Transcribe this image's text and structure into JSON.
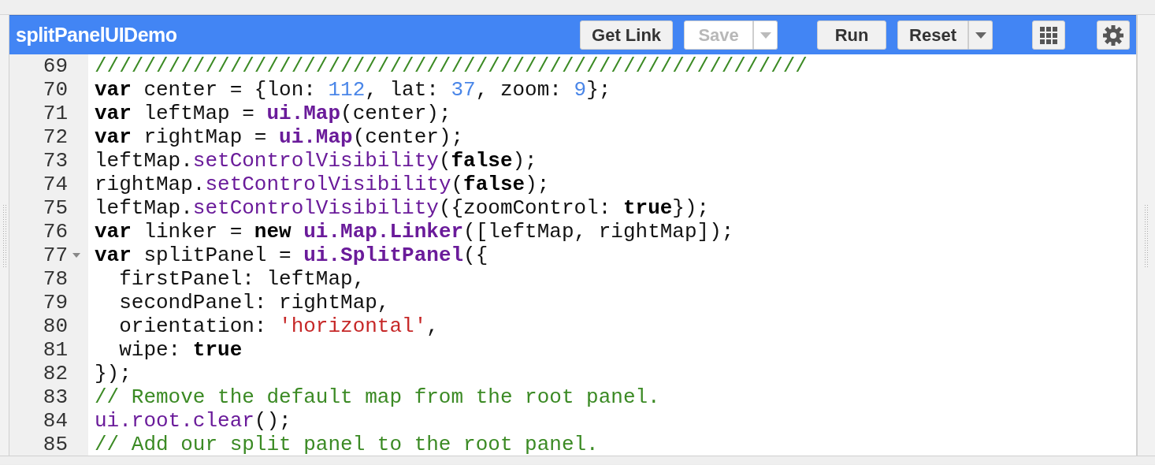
{
  "toolbar": {
    "title": "splitPanelUIDemo",
    "buttons": [
      {
        "label": "Get Link",
        "kind": "plain",
        "disabled": false
      },
      {
        "label": "Save",
        "kind": "split",
        "disabled": true
      },
      {
        "label": "Run",
        "kind": "plain",
        "disabled": false
      },
      {
        "label": "Reset",
        "kind": "split",
        "disabled": false
      },
      {
        "kind": "apps"
      },
      {
        "kind": "settings"
      }
    ]
  },
  "editor": {
    "lines": [
      {
        "number": "69",
        "foldable": false,
        "tokens": [
          {
            "kind": "com",
            "t": "//////////////////////////////////////////////////////////"
          }
        ]
      },
      {
        "number": "70",
        "foldable": false,
        "tokens": [
          {
            "kind": "kw",
            "t": "var"
          },
          {
            "kind": "plain",
            "t": " center = {lon: "
          },
          {
            "kind": "num",
            "t": "112"
          },
          {
            "kind": "plain",
            "t": ", lat: "
          },
          {
            "kind": "num",
            "t": "37"
          },
          {
            "kind": "plain",
            "t": ", zoom: "
          },
          {
            "kind": "num",
            "t": "9"
          },
          {
            "kind": "plain",
            "t": "};"
          }
        ]
      },
      {
        "number": "71",
        "foldable": false,
        "tokens": [
          {
            "kind": "kw",
            "t": "var"
          },
          {
            "kind": "plain",
            "t": " leftMap = "
          },
          {
            "kind": "fnb",
            "t": "ui.Map"
          },
          {
            "kind": "plain",
            "t": "(center);"
          }
        ]
      },
      {
        "number": "72",
        "foldable": false,
        "tokens": [
          {
            "kind": "kw",
            "t": "var"
          },
          {
            "kind": "plain",
            "t": " rightMap = "
          },
          {
            "kind": "fnb",
            "t": "ui.Map"
          },
          {
            "kind": "plain",
            "t": "(center);"
          }
        ]
      },
      {
        "number": "73",
        "foldable": false,
        "tokens": [
          {
            "kind": "plain",
            "t": "leftMap."
          },
          {
            "kind": "fn",
            "t": "setControlVisibility"
          },
          {
            "kind": "plain",
            "t": "("
          },
          {
            "kind": "kw",
            "t": "false"
          },
          {
            "kind": "plain",
            "t": ");"
          }
        ]
      },
      {
        "number": "74",
        "foldable": false,
        "tokens": [
          {
            "kind": "plain",
            "t": "rightMap."
          },
          {
            "kind": "fn",
            "t": "setControlVisibility"
          },
          {
            "kind": "plain",
            "t": "("
          },
          {
            "kind": "kw",
            "t": "false"
          },
          {
            "kind": "plain",
            "t": ");"
          }
        ]
      },
      {
        "number": "75",
        "foldable": false,
        "tokens": [
          {
            "kind": "plain",
            "t": "leftMap."
          },
          {
            "kind": "fn",
            "t": "setControlVisibility"
          },
          {
            "kind": "plain",
            "t": "({zoomControl: "
          },
          {
            "kind": "kw",
            "t": "true"
          },
          {
            "kind": "plain",
            "t": "});"
          }
        ]
      },
      {
        "number": "76",
        "foldable": false,
        "tokens": [
          {
            "kind": "kw",
            "t": "var"
          },
          {
            "kind": "plain",
            "t": " linker = "
          },
          {
            "kind": "kw",
            "t": "new"
          },
          {
            "kind": "fnb",
            "t": " ui.Map.Linker"
          },
          {
            "kind": "plain",
            "t": "([leftMap, rightMap]);"
          }
        ]
      },
      {
        "number": "77",
        "foldable": true,
        "tokens": [
          {
            "kind": "kw",
            "t": "var"
          },
          {
            "kind": "plain",
            "t": " splitPanel = "
          },
          {
            "kind": "fnb",
            "t": "ui.SplitPanel"
          },
          {
            "kind": "plain",
            "t": "({"
          }
        ]
      },
      {
        "number": "78",
        "foldable": false,
        "tokens": [
          {
            "kind": "plain",
            "t": "  firstPanel: leftMap,"
          }
        ]
      },
      {
        "number": "79",
        "foldable": false,
        "tokens": [
          {
            "kind": "plain",
            "t": "  secondPanel: rightMap,"
          }
        ]
      },
      {
        "number": "80",
        "foldable": false,
        "tokens": [
          {
            "kind": "plain",
            "t": "  orientation: "
          },
          {
            "kind": "str",
            "t": "'horizontal'"
          },
          {
            "kind": "plain",
            "t": ","
          }
        ]
      },
      {
        "number": "81",
        "foldable": false,
        "tokens": [
          {
            "kind": "plain",
            "t": "  wipe: "
          },
          {
            "kind": "kw",
            "t": "true"
          }
        ]
      },
      {
        "number": "82",
        "foldable": false,
        "tokens": [
          {
            "kind": "plain",
            "t": "});"
          }
        ]
      },
      {
        "number": "83",
        "foldable": false,
        "tokens": [
          {
            "kind": "com",
            "t": "// Remove the default map from the root panel."
          }
        ]
      },
      {
        "number": "84",
        "foldable": false,
        "tokens": [
          {
            "kind": "fn",
            "t": "ui.root.clear"
          },
          {
            "kind": "plain",
            "t": "();"
          }
        ]
      },
      {
        "number": "85",
        "foldable": false,
        "tokens": [
          {
            "kind": "com",
            "t": "// Add our split panel to the root panel."
          }
        ]
      }
    ]
  }
}
